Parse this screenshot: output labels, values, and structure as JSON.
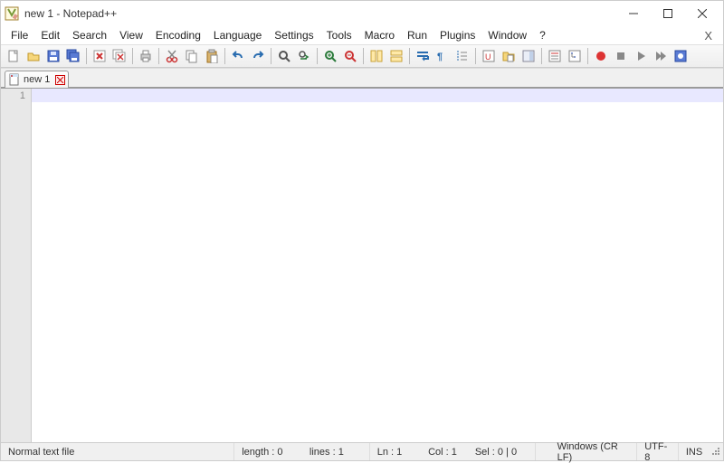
{
  "title": "new 1 - Notepad++",
  "menu": [
    "File",
    "Edit",
    "Search",
    "View",
    "Encoding",
    "Language",
    "Settings",
    "Tools",
    "Macro",
    "Run",
    "Plugins",
    "Window",
    "?"
  ],
  "tab": {
    "label": "new 1"
  },
  "gutter_line1": "1",
  "status": {
    "filetype": "Normal text file",
    "length": "length : 0",
    "lines": "lines : 1",
    "ln": "Ln : 1",
    "col": "Col : 1",
    "sel": "Sel : 0 | 0",
    "eol": "Windows (CR LF)",
    "encoding": "UTF-8",
    "mode": "INS"
  },
  "toolbar_icons": [
    "new-file",
    "open-file",
    "save",
    "save-all",
    "sep",
    "close",
    "close-all",
    "sep",
    "print",
    "sep",
    "cut",
    "copy",
    "paste",
    "sep",
    "undo",
    "redo",
    "sep",
    "find",
    "replace",
    "sep",
    "zoom-in",
    "zoom-out",
    "sep",
    "sync-v",
    "sync-h",
    "sep",
    "word-wrap",
    "all-chars",
    "indent-guide",
    "sep",
    "lang-ud",
    "folder-doc",
    "doc-map",
    "sep",
    "func-list",
    "folder-tree",
    "sep",
    "record",
    "stop",
    "play",
    "play-multi",
    "save-macro"
  ],
  "colors": {
    "accent": "#2a7ab0",
    "tabborder": "#9a9a9a"
  }
}
